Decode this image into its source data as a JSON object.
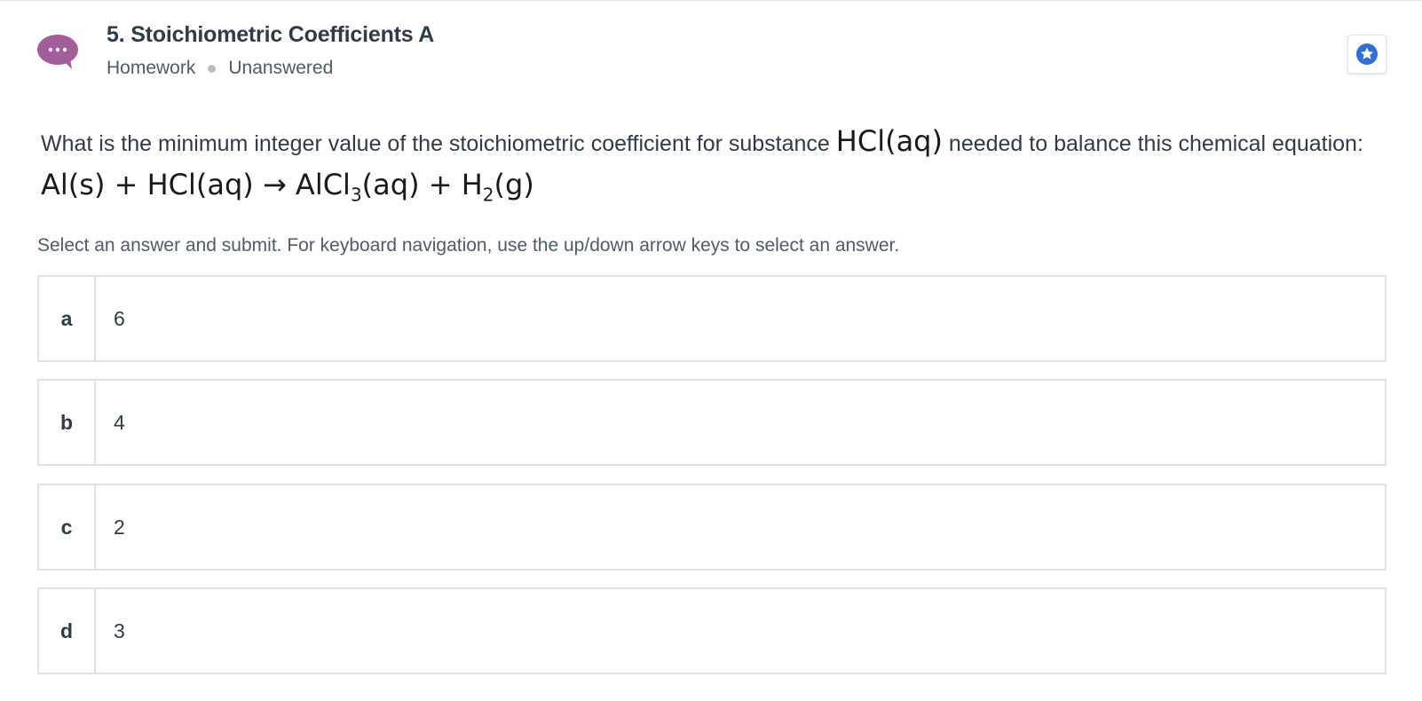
{
  "header": {
    "title": "5. Stoichiometric Coefficients A",
    "category": "Homework",
    "status": "Unanswered",
    "avatar_icon": "chat-bubble-ellipsis-icon",
    "avatar_color": "#a15e9a",
    "bookmark_icon": "star-badge-icon",
    "bookmark_color": "#2f6fd6"
  },
  "question": {
    "text_before": "What is the minimum integer value of the stoichiometric coefficient for substance ",
    "substance": "HCl(aq)",
    "text_after": " needed to balance this chemical equation: ",
    "equation": {
      "r1": "Al(s)",
      "plus1": "+",
      "r2": "HCl(aq)",
      "arrow": "→",
      "p1_base": "AlCl",
      "p1_sub": "3",
      "p1_state": "(aq)",
      "plus2": "+",
      "p2_base": "H",
      "p2_sub": "2",
      "p2_state": "(g)"
    }
  },
  "instructions": "Select an answer and submit. For keyboard navigation, use the up/down arrow keys to select an answer.",
  "options": [
    {
      "letter": "a",
      "value": "6"
    },
    {
      "letter": "b",
      "value": "4"
    },
    {
      "letter": "c",
      "value": "2"
    },
    {
      "letter": "d",
      "value": "3"
    }
  ]
}
